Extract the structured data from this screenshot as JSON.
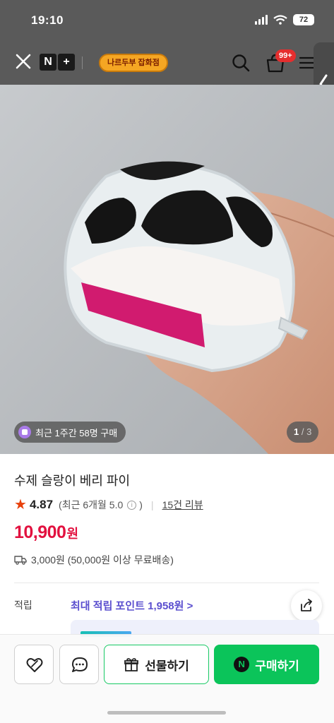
{
  "status_bar": {
    "time": "19:10",
    "battery": "72"
  },
  "nav": {
    "logo_letters": [
      "N",
      "+"
    ],
    "store_name": "나르두부 잡화점",
    "cart_count": "99+",
    "icons": [
      "close-icon",
      "search-icon",
      "cart-icon",
      "menu-icon",
      "chevron-left-icon"
    ]
  },
  "image": {
    "recent_buyers": "최근 1주간 58명 구매",
    "counter_current": "1",
    "counter_total": "3"
  },
  "product": {
    "title": "수제 슬랑이 베리 파이",
    "rating": "4.87",
    "rating_detail": "(최근 6개월 5.0",
    "info_mark": "i",
    "rating_detail_close": ")",
    "review_link": "15건 리뷰",
    "price": "10,900",
    "price_unit": "원",
    "shipping": "3,000원 (50,000원 이상 무료배송)"
  },
  "points": {
    "label": "적립",
    "value": "최대 적립 포인트 1,958원 >"
  },
  "bottom_bar": {
    "gift_label": "선물하기",
    "buy_label": "구매하기",
    "npay_letter": "N"
  },
  "colors": {
    "price_red": "#e2113f",
    "points_purple": "#5b4fcf",
    "buy_green": "#0bc45a",
    "cart_badge_red": "#e52e2e",
    "rating_star": "#e8410b"
  }
}
